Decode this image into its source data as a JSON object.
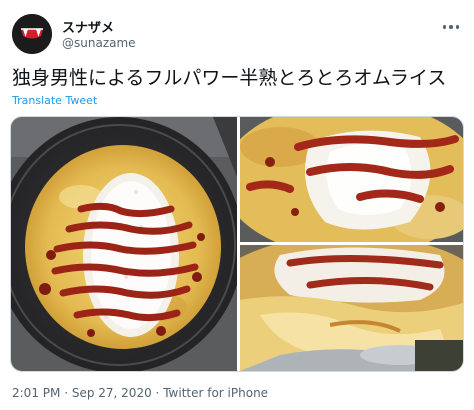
{
  "tweet": {
    "author": {
      "display_name": "スナザメ",
      "handle": "@sunazame",
      "avatar_icon": "fanged-mouth-avatar"
    },
    "text": "独身男性によるフルパワー半熟とろとろオムライス",
    "translate_label": "Translate Tweet",
    "more_icon": "more-icon",
    "media": [
      {
        "name": "omurice-in-pan-photo"
      },
      {
        "name": "omurice-closeup-photo"
      },
      {
        "name": "omurice-cut-photo"
      }
    ],
    "time": "2:01 PM",
    "separator": "·",
    "date": "Sep 27, 2020",
    "source": "Twitter for iPhone"
  },
  "colors": {
    "link": "#1d9bf0",
    "secondary_text": "#536471",
    "primary_text": "#0f1419",
    "egg": "#e7c25d",
    "ketchup": "#a8301f",
    "pan": "#2b2b2d"
  }
}
